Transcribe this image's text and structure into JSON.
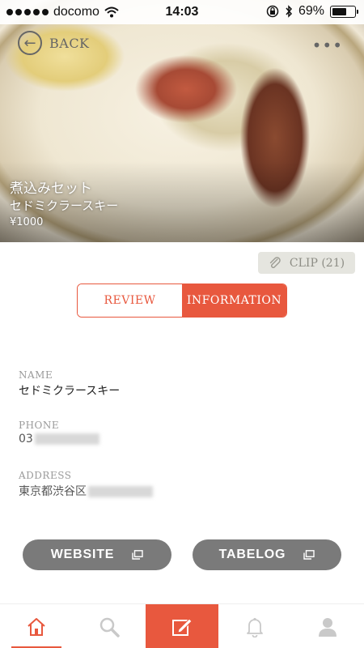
{
  "status_bar": {
    "carrier": "docomo",
    "time": "14:03",
    "battery": "69%",
    "battery_level": 0.69
  },
  "header": {
    "back_label": "BACK",
    "more_label": "•••"
  },
  "hero": {
    "dish_name": "煮込みセット",
    "shop_name": "セドミクラースキー",
    "price": "¥1000"
  },
  "clip": {
    "label": "CLIP (21)"
  },
  "tabs": {
    "review": "REVIEW",
    "information": "INFORMATION",
    "active": "information"
  },
  "info": {
    "name_label": "NAME",
    "name_value": "セドミクラースキー",
    "phone_label": "PHONE",
    "phone_value": "03",
    "address_label": "ADDRESS",
    "address_value": "東京都渋谷区"
  },
  "links": {
    "website": "WEBSITE",
    "tabelog": "TABELOG"
  },
  "tab_bar": {
    "items": [
      "home-icon",
      "search-icon",
      "compose-icon",
      "bell-icon",
      "profile-icon"
    ],
    "active": "home-icon",
    "highlight": "compose-icon"
  },
  "colors": {
    "accent": "#e8583e",
    "gray_button": "#7a7a7a",
    "icon_gray": "#c9c9c9"
  }
}
